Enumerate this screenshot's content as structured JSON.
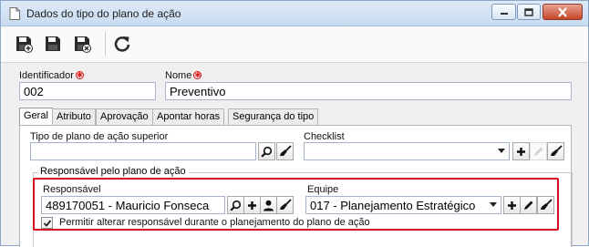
{
  "window": {
    "title": "Dados do tipo do plano de ação"
  },
  "toolbar": {
    "buttons": [
      {
        "name": "save-new-icon"
      },
      {
        "name": "save-icon"
      },
      {
        "name": "save-close-icon"
      },
      {
        "name": "refresh-icon"
      }
    ]
  },
  "fields": {
    "identificador": {
      "label": "Identificador",
      "value": "002"
    },
    "nome": {
      "label": "Nome",
      "value": "Preventivo"
    }
  },
  "tabs": [
    {
      "label": "Geral",
      "active": true
    },
    {
      "label": "Atributo",
      "active": false
    },
    {
      "label": "Aprovação",
      "active": false
    },
    {
      "label": "Apontar horas",
      "active": false
    },
    {
      "label": "Segurança do tipo",
      "active": false
    }
  ],
  "geral": {
    "tipo_superior": {
      "label": "Tipo de plano de ação superior",
      "value": ""
    },
    "checklist": {
      "label": "Checklist",
      "value": ""
    },
    "responsavel_group": {
      "legend": "Responsável pelo plano de ação",
      "responsavel": {
        "label": "Responsável",
        "value": "489170051 - Mauricio Fonseca"
      },
      "equipe": {
        "label": "Equipe",
        "value": "017 - Planejamento Estratégico"
      },
      "permitir": {
        "label": "Permitir alterar responsável durante o planejamento do plano de ação",
        "checked": true
      }
    }
  },
  "colors": {
    "highlight": "#d20e1e",
    "required": "#dd1111"
  }
}
